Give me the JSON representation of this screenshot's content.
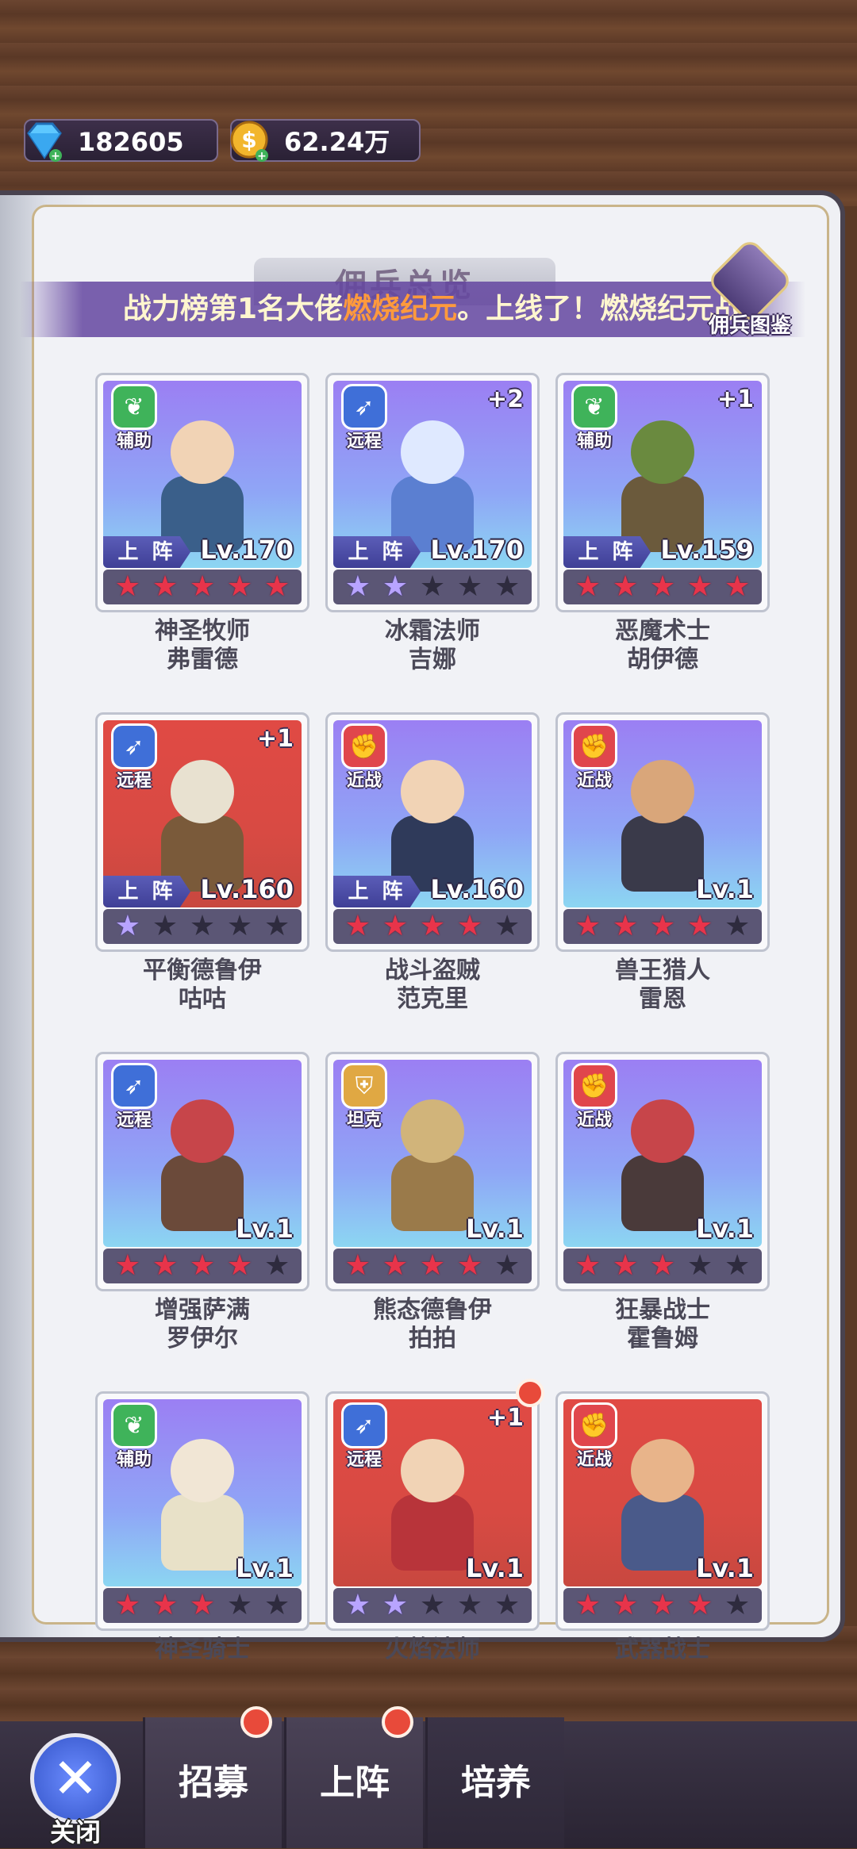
{
  "currency": {
    "gems": "182605",
    "gold": "62.24万"
  },
  "header": {
    "tab_title": "佣兵总览",
    "marquee_prefix": "战力榜第1名大佬",
    "marquee_name": "燃烧纪元",
    "marquee_mid": "。上线了！",
    "marquee_tail": "燃烧纪元战",
    "codex_label": "佣兵图鉴"
  },
  "deploy_label": "上 阵",
  "heroes": [
    {
      "role": "辅助",
      "role_icon": "leaf-icon",
      "level": "Lv.170",
      "deployed": true,
      "plus": "",
      "stars": 5,
      "star_color": "red",
      "bg": "purple",
      "name1": "神圣牧师",
      "name2": "弗雷德"
    },
    {
      "role": "远程",
      "role_icon": "bow-icon",
      "level": "Lv.170",
      "deployed": true,
      "plus": "+2",
      "stars": 2,
      "star_color": "purple",
      "bg": "purple",
      "name1": "冰霜法师",
      "name2": "吉娜"
    },
    {
      "role": "辅助",
      "role_icon": "leaf-icon",
      "level": "Lv.159",
      "deployed": true,
      "plus": "+1",
      "stars": 5,
      "star_color": "red",
      "bg": "purple",
      "name1": "恶魔术士",
      "name2": "胡伊德"
    },
    {
      "role": "远程",
      "role_icon": "bow-icon",
      "level": "Lv.160",
      "deployed": true,
      "plus": "+1",
      "stars": 1,
      "star_color": "purple",
      "bg": "red",
      "name1": "平衡德鲁伊",
      "name2": "咕咕"
    },
    {
      "role": "近战",
      "role_icon": "fist-icon",
      "level": "Lv.160",
      "deployed": true,
      "plus": "",
      "stars": 4,
      "star_color": "red",
      "bg": "purple",
      "name1": "战斗盗贼",
      "name2": "范克里"
    },
    {
      "role": "近战",
      "role_icon": "fist-icon",
      "level": "Lv.1",
      "deployed": false,
      "plus": "",
      "stars": 4,
      "star_color": "red",
      "bg": "purple",
      "name1": "兽王猎人",
      "name2": "雷恩"
    },
    {
      "role": "远程",
      "role_icon": "bow-icon",
      "level": "Lv.1",
      "deployed": false,
      "plus": "",
      "stars": 4,
      "star_color": "red",
      "bg": "purple",
      "name1": "增强萨满",
      "name2": "罗伊尔"
    },
    {
      "role": "坦克",
      "role_icon": "shield-icon",
      "level": "Lv.1",
      "deployed": false,
      "plus": "",
      "stars": 4,
      "star_color": "red",
      "bg": "purple",
      "name1": "熊态德鲁伊",
      "name2": "拍拍"
    },
    {
      "role": "近战",
      "role_icon": "fist-icon",
      "level": "Lv.1",
      "deployed": false,
      "plus": "",
      "stars": 3,
      "star_color": "red",
      "bg": "purple",
      "name1": "狂暴战士",
      "name2": "霍鲁姆"
    },
    {
      "role": "辅助",
      "role_icon": "leaf-icon",
      "level": "Lv.1",
      "deployed": false,
      "plus": "",
      "stars": 3,
      "star_color": "red",
      "bg": "purple",
      "name1": "神圣骑士",
      "name2": ""
    },
    {
      "role": "远程",
      "role_icon": "bow-icon",
      "level": "Lv.1",
      "deployed": false,
      "plus": "+1",
      "stars": 2,
      "star_color": "purple",
      "bg": "red",
      "name1": "火焰法师",
      "name2": "",
      "notify": true
    },
    {
      "role": "近战",
      "role_icon": "fist-icon",
      "level": "Lv.1",
      "deployed": false,
      "plus": "",
      "stars": 4,
      "star_color": "red",
      "bg": "red",
      "name1": "武器战士",
      "name2": ""
    }
  ],
  "bottom": {
    "close_label": "关闭",
    "tabs": [
      {
        "label": "招募",
        "notify": true
      },
      {
        "label": "上阵",
        "notify": true
      },
      {
        "label": "培养",
        "notify": false
      }
    ]
  },
  "colors": {
    "accent_purple": "#5b5db8",
    "star_red": "#e8344a",
    "star_purple": "#b8a4ff",
    "notify_red": "#e84a3a"
  }
}
